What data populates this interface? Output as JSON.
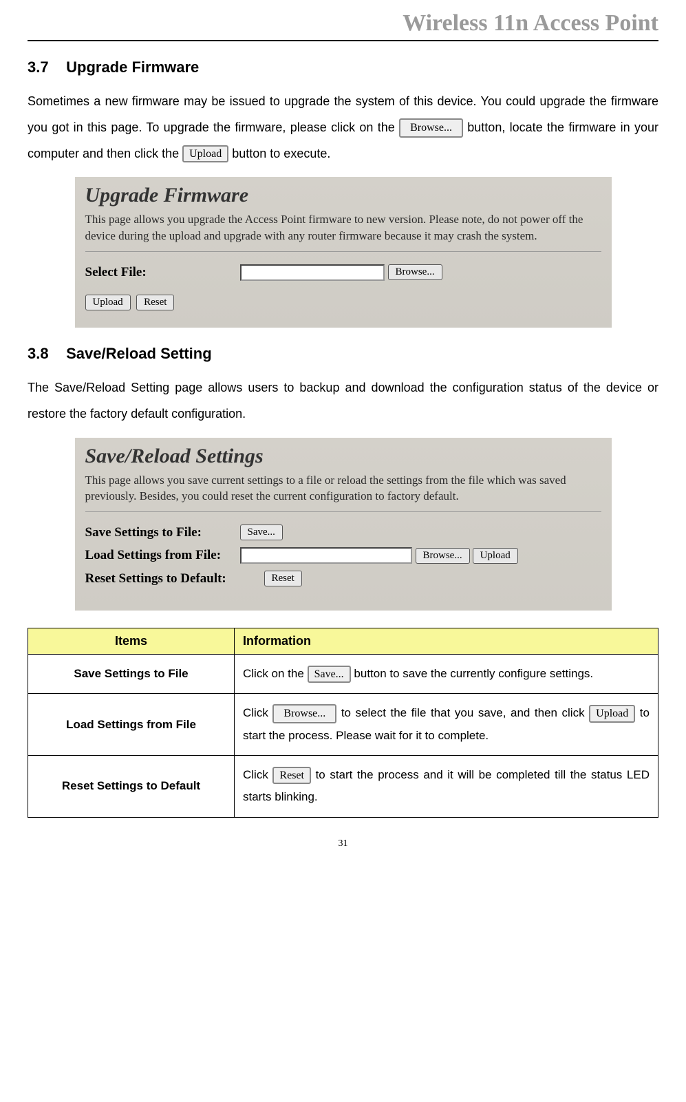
{
  "header": {
    "title": "Wireless 11n Access Point"
  },
  "section37": {
    "num": "3.7",
    "title": "Upgrade Firmware",
    "para_1": "Sometimes a new firmware may be issued to upgrade the system of this device. You could upgrade the firmware you got in this page. To upgrade the firmware, please click on the ",
    "browse_btn": "Browse...",
    "para_2": " button, locate the firmware in your computer and then click the ",
    "upload_btn": "Upload",
    "para_3": " button to execute.",
    "screenshot": {
      "title": "Upgrade Firmware",
      "desc": "This page allows you upgrade the Access Point firmware to new version. Please note, do not power off the device during the upload and upgrade with any router firmware because it may crash the system.",
      "select_file_label": "Select File:",
      "browse": "Browse...",
      "upload": "Upload",
      "reset": "Reset"
    }
  },
  "section38": {
    "num": "3.8",
    "title": "Save/Reload Setting",
    "para": "The Save/Reload Setting page allows users to backup and download the configuration status of the device or restore the factory default configuration.",
    "screenshot": {
      "title": "Save/Reload Settings",
      "desc": "This page allows you save current settings to a file or reload the settings from the file which was saved previously. Besides, you could reset the current configuration to factory default.",
      "save_label": "Save Settings to File:",
      "save_btn": "Save...",
      "load_label": "Load Settings from File:",
      "browse_btn": "Browse...",
      "upload_btn": "Upload",
      "reset_label": "Reset Settings to Default:",
      "reset_btn": "Reset"
    },
    "table": {
      "header_items": "Items",
      "header_info": "Information",
      "rows": [
        {
          "item": "Save Settings to File",
          "info_1": "Click on the",
          "btn_1": "Save...",
          "info_2": " button to save the currently configure settings."
        },
        {
          "item": "Load Settings from File",
          "info_1": "Click ",
          "btn_1": "Browse...",
          "info_2": " to select the file that you save, and then click ",
          "btn_2": "Upload",
          "info_3": " to start the process. Please wait for it to complete."
        },
        {
          "item": "Reset Settings to Default",
          "info_1": "Click ",
          "btn_1": "Reset",
          "info_2": " to start the process and it will be completed till the status LED starts blinking."
        }
      ]
    }
  },
  "page_number": "31"
}
